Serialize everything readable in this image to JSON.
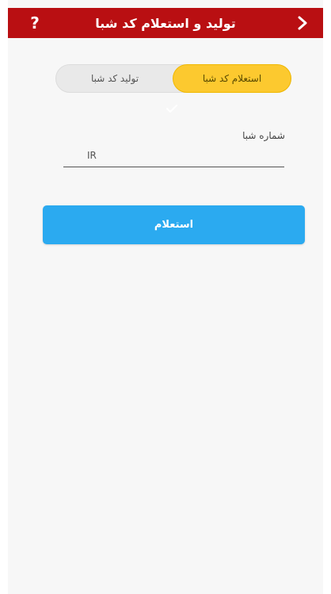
{
  "header": {
    "title": "تولید و استعلام کد شبا",
    "help_icon": "question-mark-icon",
    "back_icon": "chevron-right-icon",
    "background": "#b90f12"
  },
  "tabs": {
    "active_label": "استعلام کد شبا",
    "inactive_label": "تولید کد شبا",
    "active_color": "#fcc92f"
  },
  "form": {
    "field_label": "شماره شبا",
    "iban_placeholder": "IR",
    "submit_label": "استعلام",
    "submit_color": "#2baaf0"
  }
}
